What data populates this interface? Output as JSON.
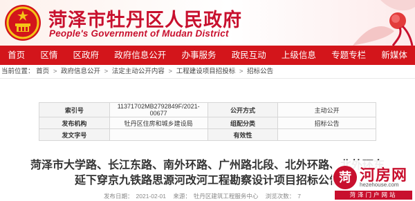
{
  "header": {
    "title": "菏泽市牡丹区人民政府",
    "subtitle": "People's Government of Mudan District"
  },
  "nav": [
    "首页",
    "区情",
    "区政府",
    "政府信息公开",
    "办事服务",
    "政民互动",
    "上级信息",
    "专题专栏",
    "新媒体"
  ],
  "breadcrumb": {
    "prefix": "当前位置：",
    "items": [
      "首页",
      "政府信息公开",
      "法定主动公开内容",
      "工程建设项目招投标",
      "招标公告"
    ],
    "separator": ">"
  },
  "info": {
    "index_label": "索引号",
    "index_value": "11371702MB2792849F/2021-00677",
    "method_label": "公开方式",
    "method_value": "主动公开",
    "org_label": "发布机构",
    "org_value": "牡丹区住房和城乡建设局",
    "form_label": "组配分类",
    "form_value": "招标公告",
    "docno_label": "发文字号",
    "docno_value": "",
    "valid_label": "有效性",
    "valid_value": ""
  },
  "document": {
    "title_line1": "菏泽市大学路、长江东路、南外环路、广州路北段、北外环路、北外环东",
    "title_line2": "延下穿京九铁路思源河改河工程勘察设计项目招标公告"
  },
  "meta": {
    "date_label": "发布日期：",
    "date": "2021-02-01",
    "source_label": "来源：",
    "source": "牡丹区建筑工程服务中心",
    "views_label": "浏览次数：",
    "views": "7"
  },
  "watermark": {
    "logo": "菏",
    "name": "河房网",
    "url": "hezehouse.com",
    "tag": "菏泽门户网站"
  },
  "colors": {
    "brand_red": "#d3151b",
    "title_red": "#c8102e"
  }
}
